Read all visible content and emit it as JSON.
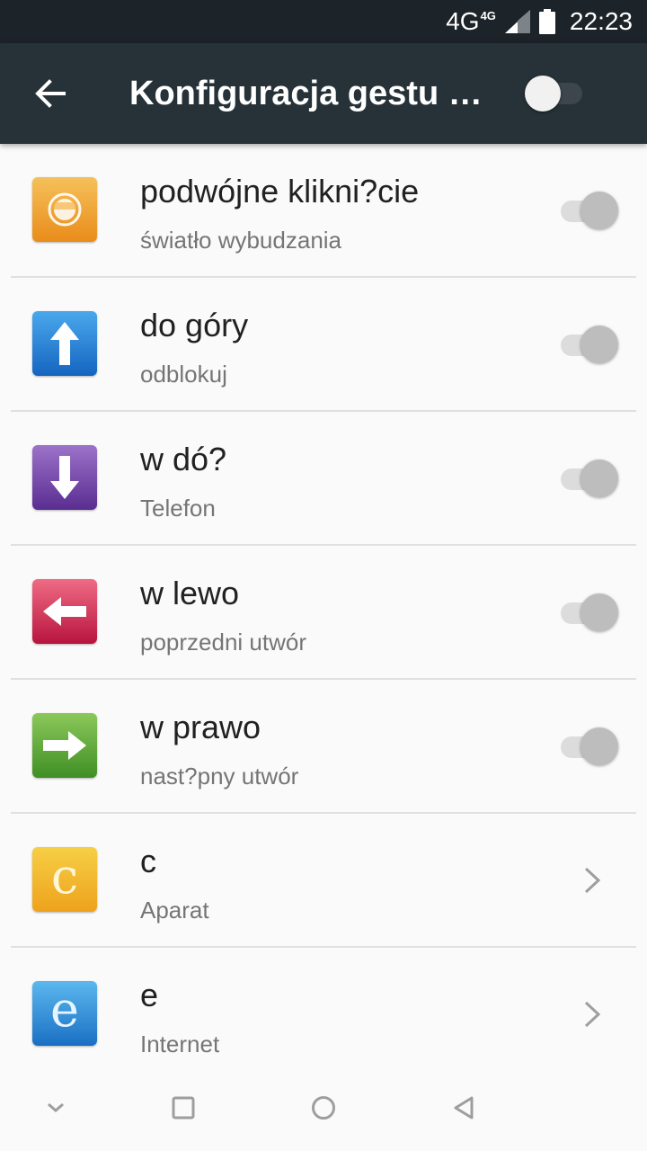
{
  "status_bar": {
    "network": "4G",
    "network_small": "4G",
    "time": "22:23",
    "icons": [
      "signal-icon",
      "battery-icon"
    ]
  },
  "app_bar": {
    "title": "Konfiguracja gestu w...",
    "back_icon": "arrow-back-icon",
    "master_switch_on": false
  },
  "items": [
    {
      "title": "podwójne klikni?cie",
      "subtitle": "światło wybudzania",
      "icon": "double-tap-icon",
      "control": "toggle",
      "enabled": false,
      "color_top": "#f5c15a",
      "color_bottom": "#e98c1a"
    },
    {
      "title": "do góry",
      "subtitle": "odblokuj",
      "icon": "arrow-up-icon",
      "control": "toggle",
      "enabled": false,
      "color_top": "#4aa8ec",
      "color_bottom": "#1565c0"
    },
    {
      "title": "w dó?",
      "subtitle": "Telefon",
      "icon": "arrow-down-icon",
      "control": "toggle",
      "enabled": false,
      "color_top": "#9c72c9",
      "color_bottom": "#5a2d91"
    },
    {
      "title": "w lewo",
      "subtitle": "poprzedni utwór",
      "icon": "arrow-left-icon",
      "control": "toggle",
      "enabled": false,
      "color_top": "#ef6b84",
      "color_bottom": "#b8143e"
    },
    {
      "title": "w prawo",
      "subtitle": "nast?pny utwór",
      "icon": "arrow-right-icon",
      "control": "toggle",
      "enabled": false,
      "color_top": "#8cc85a",
      "color_bottom": "#3f8f25"
    },
    {
      "title": "c",
      "subtitle": "Aparat",
      "icon": "letter-c-icon",
      "glyph": "c",
      "control": "chevron",
      "color_top": "#f6cf45",
      "color_bottom": "#eea21c"
    },
    {
      "title": "e",
      "subtitle": "Internet",
      "icon": "letter-e-icon",
      "glyph": "e",
      "control": "chevron",
      "color_top": "#5cb8ee",
      "color_bottom": "#1a6fc4"
    }
  ],
  "nav_bar": {
    "icons": [
      "nav-collapse-icon",
      "nav-recents-icon",
      "nav-home-icon",
      "nav-back-icon"
    ]
  }
}
